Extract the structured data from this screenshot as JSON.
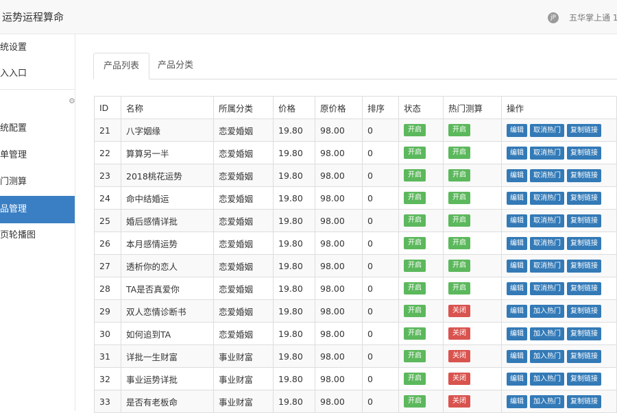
{
  "header": {
    "title": "运势运程算命",
    "user_avatar_text": "jP",
    "user_name": "五华掌上通 1"
  },
  "sidebar": {
    "items": [
      {
        "label": "统设置"
      },
      {
        "label": "入入口"
      },
      {
        "label": "统配置"
      },
      {
        "label": "单管理"
      },
      {
        "label": "门测算"
      },
      {
        "label": "品管理"
      },
      {
        "label": "页轮播图"
      }
    ],
    "active_index": 5
  },
  "tabs": [
    {
      "label": "产品列表"
    },
    {
      "label": "产品分类"
    }
  ],
  "table": {
    "headers": [
      "ID",
      "名称",
      "所属分类",
      "价格",
      "原价格",
      "排序",
      "状态",
      "热门测算",
      "操作"
    ],
    "labels": {
      "status_on": "开启",
      "status_off": "关闭",
      "edit": "编辑",
      "cancel_hot": "取消热门",
      "add_hot": "加入热门",
      "copy_link": "复制链接"
    },
    "rows": [
      {
        "id": "21",
        "name": "八字姻缘",
        "category": "恋爱婚姻",
        "price": "19.80",
        "original_price": "98.00",
        "sort": "0",
        "status": "on",
        "hot": "on"
      },
      {
        "id": "22",
        "name": "算算另一半",
        "category": "恋爱婚姻",
        "price": "19.80",
        "original_price": "98.00",
        "sort": "0",
        "status": "on",
        "hot": "on"
      },
      {
        "id": "23",
        "name": "2018桃花运势",
        "category": "恋爱婚姻",
        "price": "19.80",
        "original_price": "98.00",
        "sort": "0",
        "status": "on",
        "hot": "on"
      },
      {
        "id": "24",
        "name": "命中结婚运",
        "category": "恋爱婚姻",
        "price": "19.80",
        "original_price": "98.00",
        "sort": "0",
        "status": "on",
        "hot": "on"
      },
      {
        "id": "25",
        "name": "婚后感情详批",
        "category": "恋爱婚姻",
        "price": "19.80",
        "original_price": "98.00",
        "sort": "0",
        "status": "on",
        "hot": "on"
      },
      {
        "id": "26",
        "name": "本月感情运势",
        "category": "恋爱婚姻",
        "price": "19.80",
        "original_price": "98.00",
        "sort": "0",
        "status": "on",
        "hot": "on"
      },
      {
        "id": "27",
        "name": "透析你的恋人",
        "category": "恋爱婚姻",
        "price": "19.80",
        "original_price": "98.00",
        "sort": "0",
        "status": "on",
        "hot": "on"
      },
      {
        "id": "28",
        "name": "TA是否真爱你",
        "category": "恋爱婚姻",
        "price": "19.80",
        "original_price": "98.00",
        "sort": "0",
        "status": "on",
        "hot": "on"
      },
      {
        "id": "29",
        "name": "双人恋情诊断书",
        "category": "恋爱婚姻",
        "price": "19.80",
        "original_price": "98.00",
        "sort": "0",
        "status": "on",
        "hot": "off"
      },
      {
        "id": "30",
        "name": "如何追到TA",
        "category": "恋爱婚姻",
        "price": "19.80",
        "original_price": "98.00",
        "sort": "0",
        "status": "on",
        "hot": "off"
      },
      {
        "id": "31",
        "name": "详批一生财富",
        "category": "事业财富",
        "price": "19.80",
        "original_price": "98.00",
        "sort": "0",
        "status": "on",
        "hot": "off"
      },
      {
        "id": "32",
        "name": "事业运势详批",
        "category": "事业财富",
        "price": "19.80",
        "original_price": "98.00",
        "sort": "0",
        "status": "on",
        "hot": "off"
      },
      {
        "id": "33",
        "name": "是否有老板命",
        "category": "事业财富",
        "price": "19.80",
        "original_price": "98.00",
        "sort": "0",
        "status": "on",
        "hot": "off"
      }
    ]
  }
}
